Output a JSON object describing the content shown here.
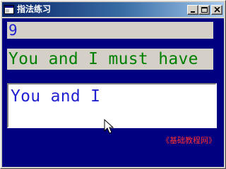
{
  "window": {
    "title": "指法练习",
    "icon": "app-icon",
    "buttons": {
      "minimize": "minimize-icon",
      "maximize": "maximize-icon",
      "close": "close-icon"
    }
  },
  "main": {
    "count_value": "9",
    "target_text": "You and I must have",
    "typed_text": "You and I",
    "footer_text": "《基础教程网》"
  },
  "colors": {
    "client_background": "#000080",
    "count_text": "#2020d0",
    "target_text": "#008000",
    "typed_text": "#2020d0",
    "footer_text": "#ff3030"
  }
}
